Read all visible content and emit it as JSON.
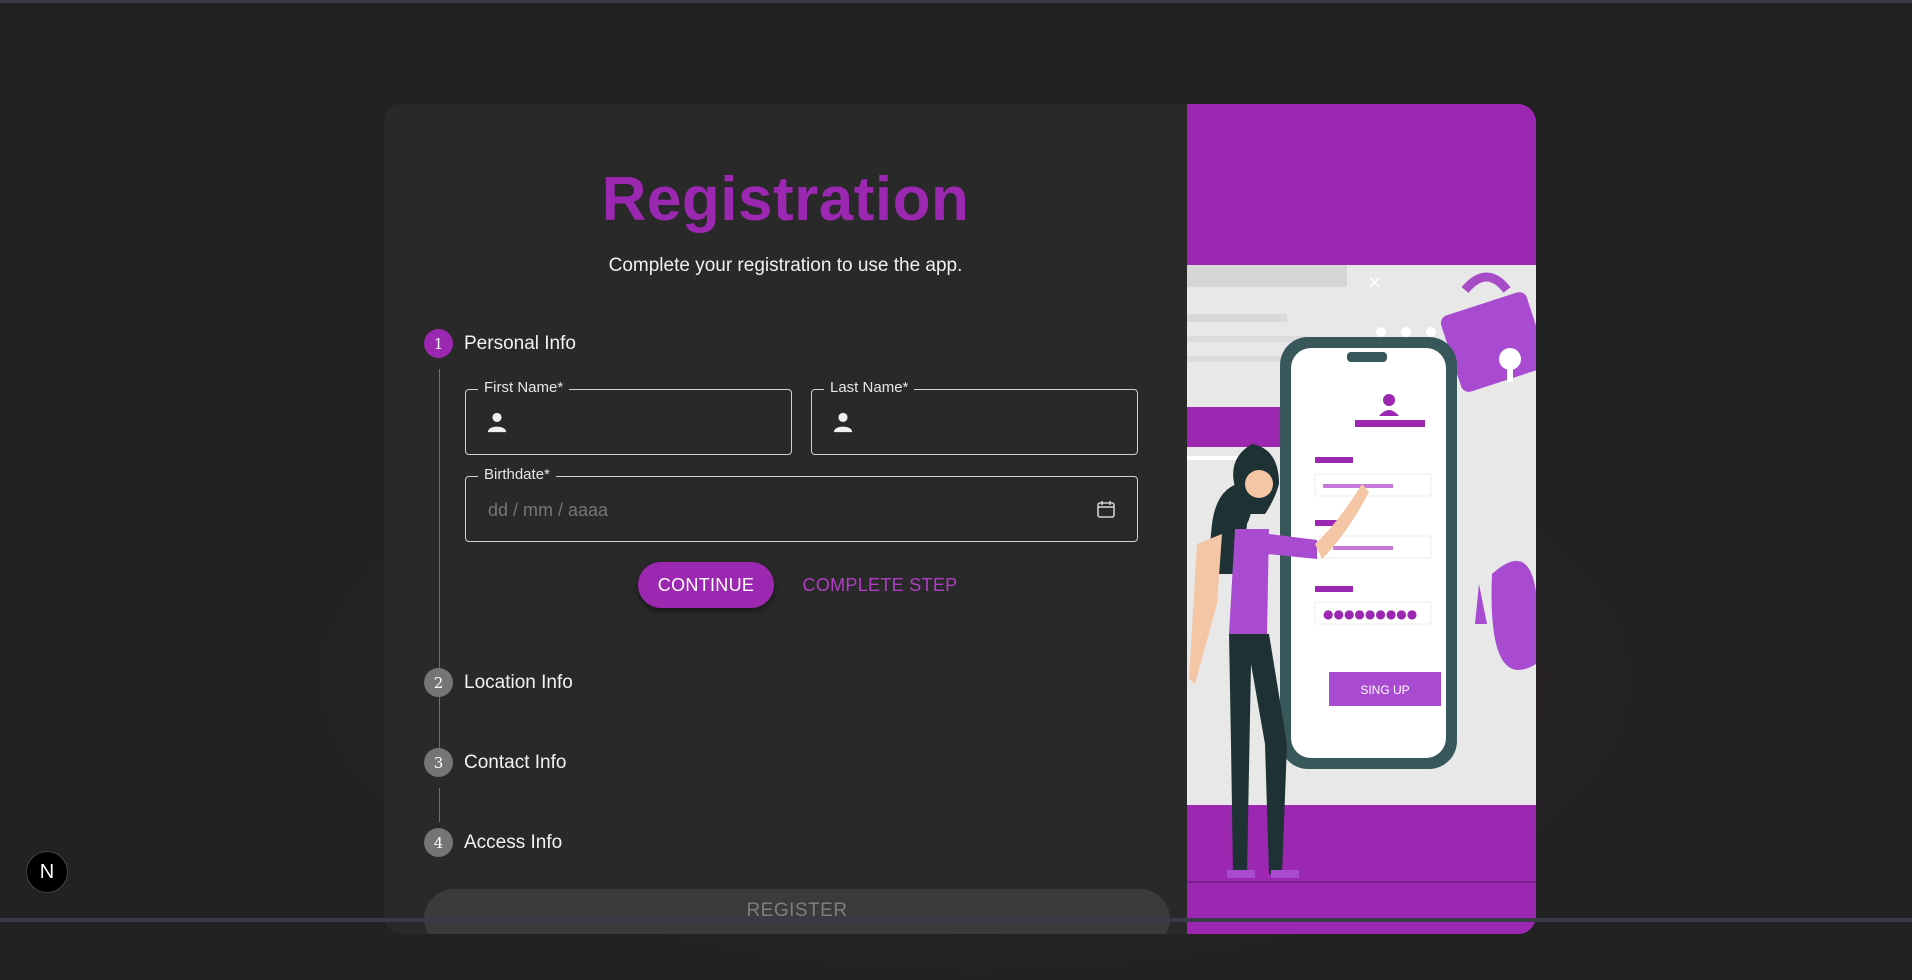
{
  "page": {
    "title": "Registration",
    "subtitle": "Complete your registration to use the app."
  },
  "steps": [
    {
      "number": "1",
      "label": "Personal Info",
      "state": "active"
    },
    {
      "number": "2",
      "label": "Location Info",
      "state": "inactive"
    },
    {
      "number": "3",
      "label": "Contact Info",
      "state": "inactive"
    },
    {
      "number": "4",
      "label": "Access Info",
      "state": "inactive"
    }
  ],
  "form": {
    "first_name": {
      "label": "First Name",
      "required_mark": "*",
      "value": "",
      "icon": "person-icon"
    },
    "last_name": {
      "label": "Last Name",
      "required_mark": "*",
      "value": "",
      "icon": "person-icon"
    },
    "birthdate": {
      "label": "Birthdate",
      "required_mark": "*",
      "placeholder": "dd / mm / aaaa",
      "icon": "calendar-icon"
    }
  },
  "actions": {
    "continue_label": "CONTINUE",
    "complete_step_label": "COMPLETE STEP",
    "register_label": "REGISTER"
  },
  "illustration": {
    "signup_button_label": "SING UP",
    "close_glyph": "×"
  },
  "badge": {
    "letter": "N"
  },
  "colors": {
    "accent": "#9c27b0",
    "background": "#232223",
    "card": "#2a292a",
    "inactive_step": "#757575"
  }
}
